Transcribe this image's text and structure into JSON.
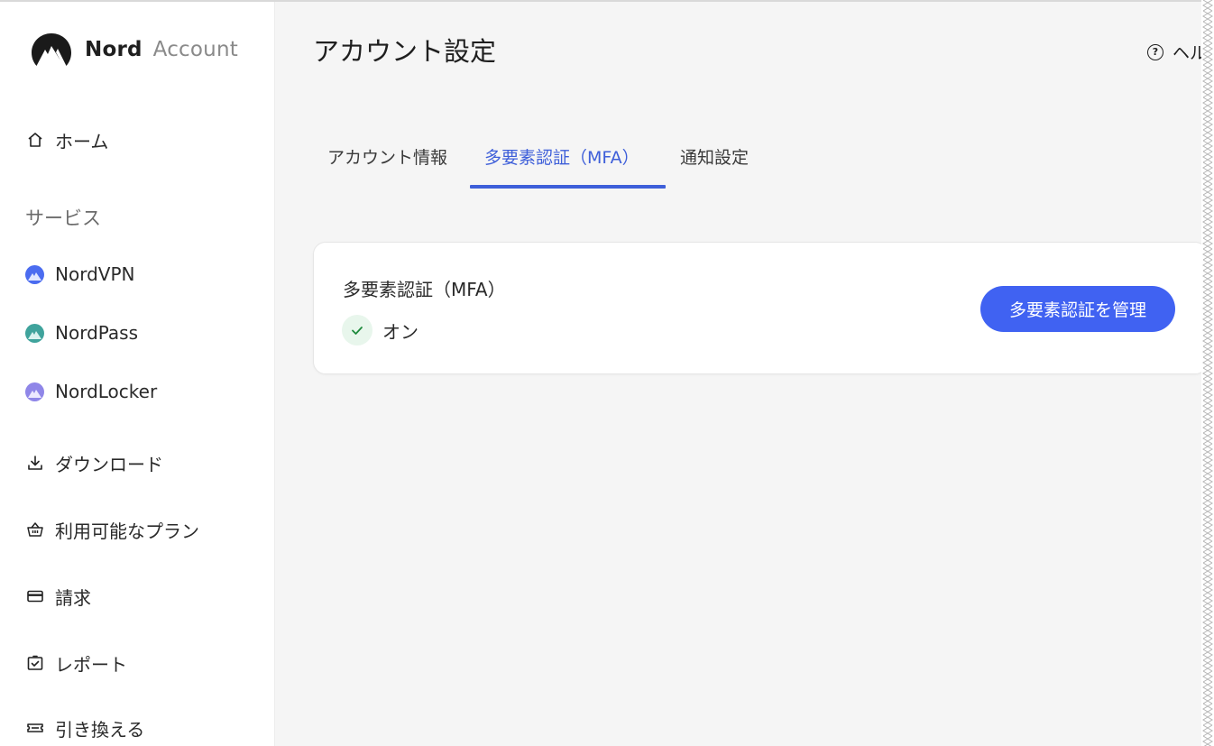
{
  "brand": {
    "name_bold": "Nord",
    "name_light": "Account",
    "logo_icon": "nord-mountain-logo"
  },
  "sidebar": {
    "home": {
      "label": "ホーム",
      "icon": "home-icon"
    },
    "services_label": "サービス",
    "services": [
      {
        "label": "NordVPN",
        "color": "#4b6cf0"
      },
      {
        "label": "NordPass",
        "color": "#3fa39c"
      },
      {
        "label": "NordLocker",
        "color": "#8f86e8"
      }
    ],
    "items": [
      {
        "label": "ダウンロード",
        "icon": "download-icon"
      },
      {
        "label": "利用可能なプラン",
        "icon": "basket-icon"
      },
      {
        "label": "請求",
        "icon": "credit-card-icon"
      },
      {
        "label": "レポート",
        "icon": "report-badge-icon"
      },
      {
        "label": "引き換える",
        "icon": "ticket-icon"
      }
    ]
  },
  "header": {
    "title": "アカウント設定",
    "help_label": "ヘル"
  },
  "tabs": [
    {
      "label": "アカウント情報",
      "active": false
    },
    {
      "label": "多要素認証（MFA）",
      "active": true
    },
    {
      "label": "通知設定",
      "active": false
    }
  ],
  "mfa_card": {
    "title": "多要素認証（MFA）",
    "status": "オン",
    "status_color": "#1e8a3c",
    "button_label": "多要素認証を管理",
    "button_color": "#4062f2"
  }
}
